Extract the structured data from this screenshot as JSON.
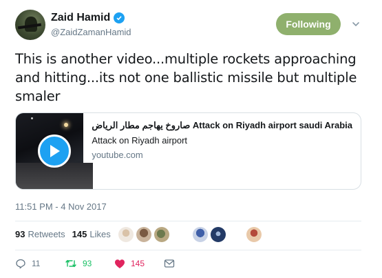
{
  "author": {
    "name": "Zaid Hamid",
    "handle": "@ZaidZamanHamid"
  },
  "follow_button": {
    "label": "Following"
  },
  "tweet": {
    "text": "This is another video...multiple rockets approaching and hitting...its not one ballistic missile but multiple smaler",
    "timestamp": "11:51 PM - 4 Nov 2017"
  },
  "card": {
    "title": "صاروخ يهاجم مطار الرياض Attack on Riyadh airport saudi Arabia",
    "description": "Attack on Riyadh airport",
    "domain": "youtube.com"
  },
  "stats": {
    "retweets_count": "93",
    "retweets_label": "Retweets",
    "likes_count": "145",
    "likes_label": "Likes"
  },
  "actions": {
    "reply_count": "11",
    "retweet_count": "93",
    "like_count": "145"
  },
  "colors": {
    "follow_bg": "#8fb06d",
    "verified": "#1da1f2",
    "retweet": "#17bf63",
    "like": "#e0245e",
    "muted": "#657786"
  },
  "icons": [
    "verified-badge-icon",
    "chevron-down-icon",
    "play-icon",
    "reply-icon",
    "retweet-icon",
    "heart-icon",
    "message-icon"
  ]
}
